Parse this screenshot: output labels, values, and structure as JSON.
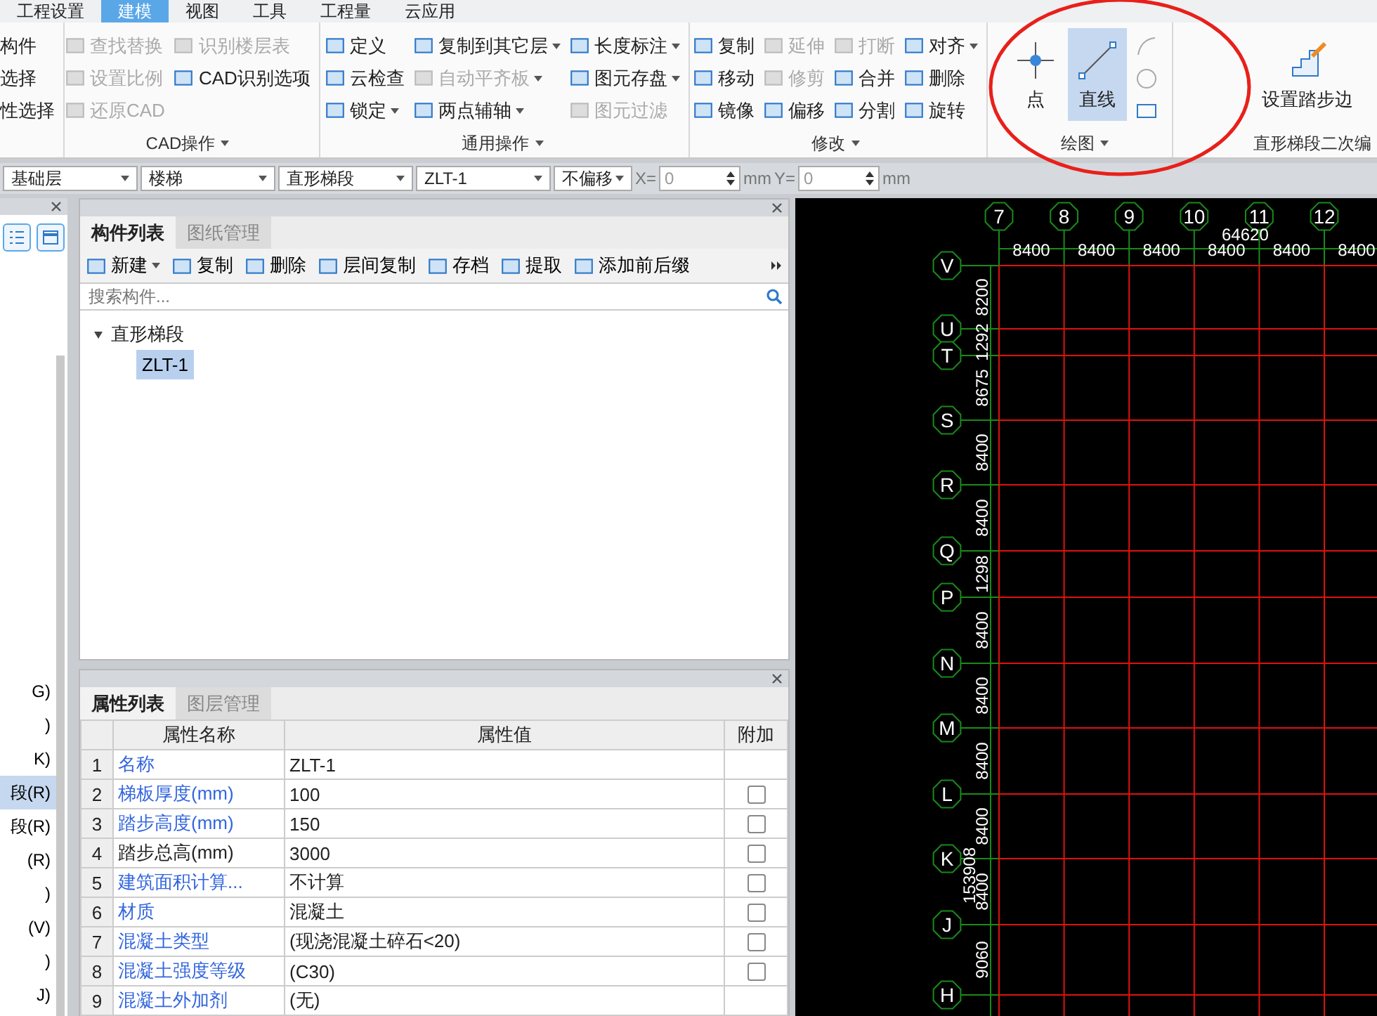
{
  "ribbon": {
    "tabs": [
      {
        "label": "工程设置",
        "selected": false
      },
      {
        "label": "建模",
        "selected": true
      },
      {
        "label": "视图",
        "selected": false
      },
      {
        "label": "工具",
        "selected": false
      },
      {
        "label": "工程量",
        "selected": false
      },
      {
        "label": "云应用",
        "selected": false
      }
    ],
    "groups": [
      {
        "kind": "plain",
        "items": [
          {
            "label": "构件",
            "disabled": false,
            "dropdown": false
          },
          {
            "label": "选择",
            "disabled": false,
            "dropdown": false
          },
          {
            "label": "性选择",
            "disabled": false,
            "dropdown": false
          }
        ]
      },
      {
        "kind": "grid",
        "title": "CAD操作",
        "items": [
          {
            "label": "查找替换",
            "disabled": true,
            "dropdown": false
          },
          {
            "label": "设置比例",
            "disabled": true,
            "dropdown": false
          },
          {
            "label": "还原CAD",
            "disabled": true,
            "dropdown": false
          },
          {
            "label": "识别楼层表",
            "disabled": true,
            "dropdown": false
          },
          {
            "label": "CAD识别选项",
            "disabled": false,
            "dropdown": false
          }
        ]
      },
      {
        "kind": "grid",
        "title": "通用操作",
        "items": [
          {
            "label": "定义",
            "disabled": false,
            "dropdown": false
          },
          {
            "label": "云检查",
            "disabled": false,
            "dropdown": false
          },
          {
            "label": "锁定",
            "disabled": false,
            "dropdown": true
          },
          {
            "label": "复制到其它层",
            "disabled": false,
            "dropdown": true
          },
          {
            "label": "自动平齐板",
            "disabled": true,
            "dropdown": true
          },
          {
            "label": "两点辅轴",
            "disabled": false,
            "dropdown": true
          },
          {
            "label": "长度标注",
            "disabled": false,
            "dropdown": true
          },
          {
            "label": "图元存盘",
            "disabled": false,
            "dropdown": true
          },
          {
            "label": "图元过滤",
            "disabled": true,
            "dropdown": false
          }
        ]
      },
      {
        "kind": "grid",
        "title": "修改",
        "items": [
          {
            "label": "复制",
            "disabled": false,
            "dropdown": false
          },
          {
            "label": "移动",
            "disabled": false,
            "dropdown": false
          },
          {
            "label": "镜像",
            "disabled": false,
            "dropdown": false
          },
          {
            "label": "延伸",
            "disabled": true,
            "dropdown": false
          },
          {
            "label": "修剪",
            "disabled": true,
            "dropdown": false
          },
          {
            "label": "偏移",
            "disabled": false,
            "dropdown": false
          },
          {
            "label": "打断",
            "disabled": true,
            "dropdown": false
          },
          {
            "label": "合并",
            "disabled": false,
            "dropdown": false
          },
          {
            "label": "分割",
            "disabled": false,
            "dropdown": false
          },
          {
            "label": "对齐",
            "disabled": false,
            "dropdown": true
          },
          {
            "label": "删除",
            "disabled": false,
            "dropdown": false
          },
          {
            "label": "旋转",
            "disabled": false,
            "dropdown": false
          }
        ]
      },
      {
        "kind": "draw",
        "title": "绘图",
        "items": [
          {
            "label": "点",
            "selected": false
          },
          {
            "label": "直线",
            "selected": true
          }
        ]
      },
      {
        "kind": "large",
        "title": "直形梯段二次编",
        "items": [
          {
            "label": "设置踏步边"
          }
        ]
      }
    ]
  },
  "toolbar": {
    "dropdowns": [
      "基础层",
      "楼梯",
      "直形梯段",
      "ZLT-1",
      "不偏移"
    ],
    "x_label": "X=",
    "x_value": "0",
    "x_unit": "mm",
    "y_label": "Y=",
    "y_value": "0",
    "y_unit": "mm"
  },
  "side_list": {
    "items": [
      {
        "label": "G)",
        "selected": false
      },
      {
        "label": ")",
        "selected": false
      },
      {
        "label": "K)",
        "selected": false
      },
      {
        "label": "段(R)",
        "selected": true
      },
      {
        "label": "段(R)",
        "selected": false
      },
      {
        "label": "(R)",
        "selected": false
      },
      {
        "label": ")",
        "selected": false
      },
      {
        "label": "(V)",
        "selected": false
      },
      {
        "label": ")",
        "selected": false
      },
      {
        "label": "J)",
        "selected": false
      }
    ]
  },
  "component_panel": {
    "tabs": [
      {
        "label": "构件列表",
        "selected": true
      },
      {
        "label": "图纸管理",
        "selected": false
      }
    ],
    "actions": [
      {
        "label": "新建",
        "dropdown": true
      },
      {
        "label": "复制",
        "dropdown": false
      },
      {
        "label": "删除",
        "dropdown": false
      },
      {
        "label": "层间复制",
        "dropdown": false
      },
      {
        "label": "存档",
        "dropdown": false
      },
      {
        "label": "提取",
        "dropdown": false
      },
      {
        "label": "添加前后缀",
        "dropdown": false
      }
    ],
    "search": {
      "placeholder": "搜索构件..."
    },
    "tree": [
      {
        "label": "直形梯段",
        "expanded": true,
        "selected": false,
        "children": [
          {
            "label": "ZLT-1",
            "selected": true
          }
        ]
      }
    ]
  },
  "property_panel": {
    "tabs": [
      {
        "label": "属性列表",
        "selected": true
      },
      {
        "label": "图层管理",
        "selected": false
      }
    ],
    "columns": [
      "属性名称",
      "属性值",
      "附加"
    ],
    "rows": [
      {
        "index": "1",
        "name": "名称",
        "value": "ZLT-1",
        "kind": "public"
      },
      {
        "index": "2",
        "name": "梯板厚度(mm)",
        "value": "100",
        "kind": "public",
        "checked": false
      },
      {
        "index": "3",
        "name": "踏步高度(mm)",
        "value": "150",
        "kind": "public",
        "checked": false
      },
      {
        "index": "4",
        "name": "踏步总高(mm)",
        "value": "3000",
        "kind": "private",
        "checked": false
      },
      {
        "index": "5",
        "name": "建筑面积计算...",
        "value": "不计算",
        "kind": "public",
        "checked": false
      },
      {
        "index": "6",
        "name": "材质",
        "value": "混凝土",
        "kind": "public",
        "checked": false
      },
      {
        "index": "7",
        "name": "混凝土类型",
        "value": "(现浇混凝土碎石<20)",
        "kind": "public",
        "checked": false
      },
      {
        "index": "8",
        "name": "混凝土强度等级",
        "value": "(C30)",
        "kind": "public",
        "checked": false
      },
      {
        "index": "9",
        "name": "混凝土外加剂",
        "value": "(无)",
        "kind": "public"
      }
    ]
  },
  "cad": {
    "column_axes": [
      "7",
      "8",
      "9",
      "10",
      "11",
      "12"
    ],
    "column_dims": [
      "8400",
      "8400",
      "8400",
      "8400",
      "8400",
      "8400"
    ],
    "column_total": "64620",
    "row_axes": [
      "V",
      "U",
      "T",
      "S",
      "R",
      "Q",
      "P",
      "N",
      "M",
      "L",
      "K",
      "J",
      "H"
    ],
    "row_dims": [
      "8200",
      "1292",
      "8675",
      "8400",
      "8400",
      "1298",
      "8400",
      "8400",
      "8400",
      "8400",
      "8400",
      "9060"
    ],
    "row_total": "153908"
  }
}
